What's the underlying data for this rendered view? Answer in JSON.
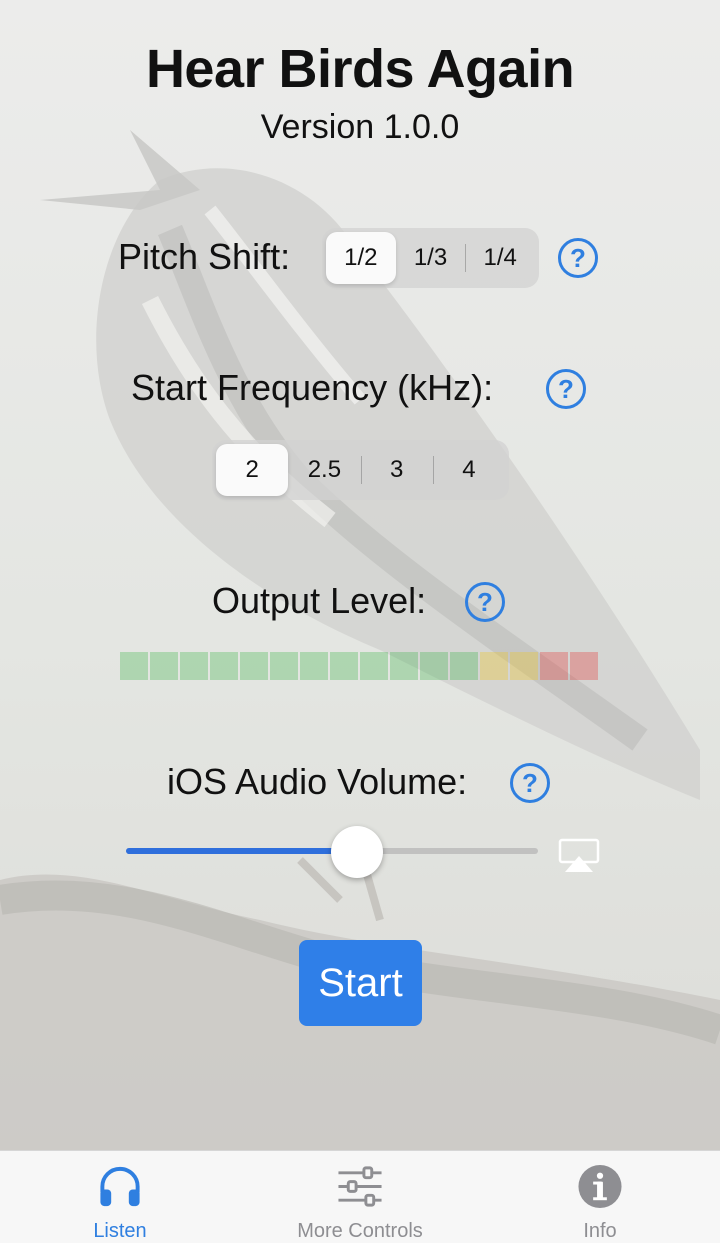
{
  "app": {
    "title": "Hear Birds Again",
    "version": "Version 1.0.0"
  },
  "pitch_shift": {
    "label": "Pitch Shift:",
    "options": [
      "1/2",
      "1/3",
      "1/4"
    ],
    "selected": "1/2",
    "help_icon": "question-mark-circle-icon"
  },
  "start_frequency": {
    "label": "Start Frequency (kHz):",
    "options": [
      "2",
      "2.5",
      "3",
      "4"
    ],
    "selected": "2",
    "help_icon": "question-mark-circle-icon"
  },
  "output_level": {
    "label": "Output Level:",
    "segments": 16,
    "level": 0,
    "segment_colors": [
      "#3db54a",
      "#3db54a",
      "#3db54a",
      "#3db54a",
      "#3db54a",
      "#3db54a",
      "#3db54a",
      "#3db54a",
      "#3db54a",
      "#3db54a",
      "#3db54a",
      "#3db54a",
      "#f0c419",
      "#f0c419",
      "#e53935",
      "#e53935"
    ],
    "help_icon": "question-mark-circle-icon"
  },
  "audio_volume": {
    "label": "iOS Audio Volume:",
    "value": 0.56,
    "help_icon": "question-mark-circle-icon",
    "route_icon": "airplay-icon"
  },
  "start_button": {
    "label": "Start"
  },
  "tabs": [
    {
      "label": "Listen",
      "icon": "headphones-icon",
      "active": true
    },
    {
      "label": "More Controls",
      "icon": "sliders-icon",
      "active": false
    },
    {
      "label": "Info",
      "icon": "info-circle-icon",
      "active": false
    }
  ],
  "colors": {
    "accent": "#2f7fe0",
    "start_button": "#2f7fe8",
    "tab_inactive": "#8e8e92"
  }
}
